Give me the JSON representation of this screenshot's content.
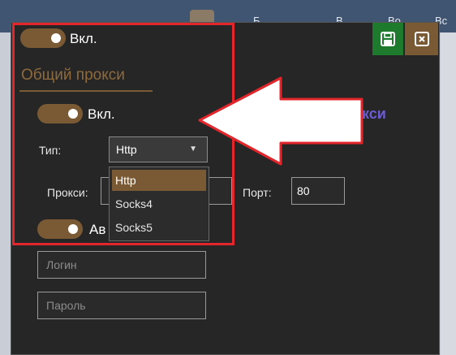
{
  "background": {
    "header_texts": [
      "Б",
      "В",
      "Во",
      "Вс"
    ],
    "proxy_label": "кси"
  },
  "dialog": {
    "save_icon": "save-icon",
    "close_icon": "close-icon",
    "main_toggle": {
      "label": "Вкл.",
      "on": true
    },
    "section_title": "Общий прокси",
    "proxy_toggle": {
      "label": "Вкл.",
      "on": true
    },
    "type": {
      "label": "Тип:",
      "selected": "Http",
      "options": [
        "Http",
        "Socks4",
        "Socks5"
      ]
    },
    "proxy": {
      "label": "Прокси:",
      "value": ""
    },
    "port": {
      "label": "Порт:",
      "value": "80"
    },
    "auth_toggle": {
      "label": "Ав",
      "on": true
    },
    "login": {
      "placeholder": "Логин"
    },
    "password": {
      "placeholder": "Пароль"
    }
  },
  "colors": {
    "accent": "#7a5a34",
    "annotation": "#e3262b",
    "save": "#1e7a2d"
  }
}
